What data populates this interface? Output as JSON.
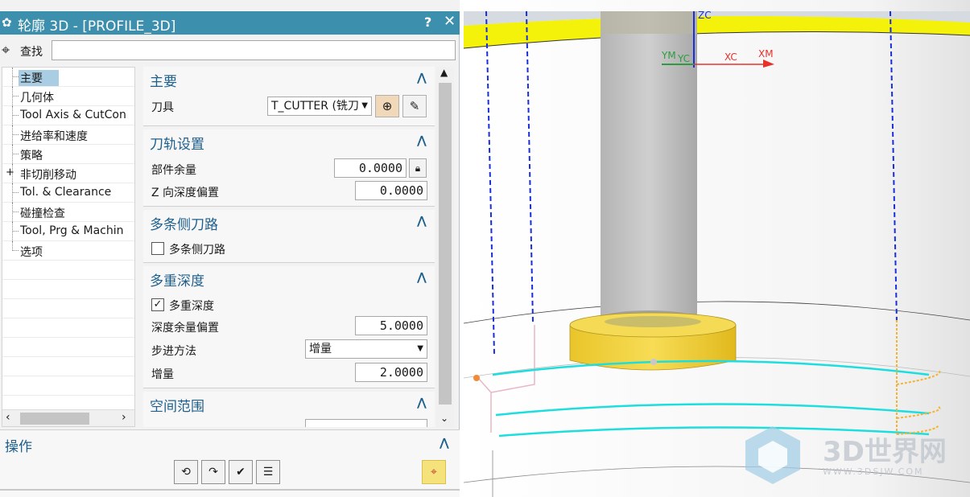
{
  "dialog": {
    "title": "轮廓 3D - [PROFILE_3D]",
    "help_label": "?",
    "close_label": "✕",
    "find_label": "查找",
    "find_value": ""
  },
  "tree": {
    "items": [
      {
        "label": "主要",
        "selected": true
      },
      {
        "label": "几何体"
      },
      {
        "label": "Tool Axis & CutCon"
      },
      {
        "label": "进给率和速度"
      },
      {
        "label": "策略"
      },
      {
        "label": "非切削移动",
        "expandable": true
      },
      {
        "label": "Tol. & Clearance"
      },
      {
        "label": "碰撞检查"
      },
      {
        "label": "Tool, Prg & Machin"
      },
      {
        "label": "选项"
      }
    ]
  },
  "sections": {
    "main": {
      "title": "主要",
      "tool_label": "刀具",
      "tool_value": "T_CUTTER (铣刀"
    },
    "toolpath": {
      "title": "刀轨设置",
      "part_stock_label": "部件余量",
      "part_stock_value": "0.0000",
      "z_offset_label": "Z 向深度偏置",
      "z_offset_value": "0.0000"
    },
    "multi_side": {
      "title": "多条侧刀路",
      "checkbox_label": "多条侧刀路",
      "checked": false
    },
    "multi_depth": {
      "title": "多重深度",
      "checkbox_label": "多重深度",
      "checked": true,
      "check_mark": "✓",
      "depth_stock_label": "深度余量偏置",
      "depth_stock_value": "5.0000",
      "step_method_label": "步进方法",
      "step_method_value": "增量",
      "increment_label": "增量",
      "increment_value": "2.0000"
    },
    "spatial_range": {
      "title": "空间范围"
    }
  },
  "actions": {
    "title": "操作"
  },
  "viewport": {
    "axis_labels": {
      "zc": "ZC",
      "ym": "YM",
      "yc": "YC",
      "xc": "XC",
      "xm": "XM"
    },
    "watermark_title": "3D世界网",
    "watermark_sub": "WWW.3DSJW.COM",
    "colors": {
      "rim_yellow": "#f4f10a",
      "tool_gray": "#c0c0c0",
      "holder_yellow": "#f3d23a",
      "path_cyan": "#1ddede",
      "path_blue": "#1a2fd6",
      "axis_red": "#e8312a",
      "axis_green": "#2c9c3f"
    }
  }
}
